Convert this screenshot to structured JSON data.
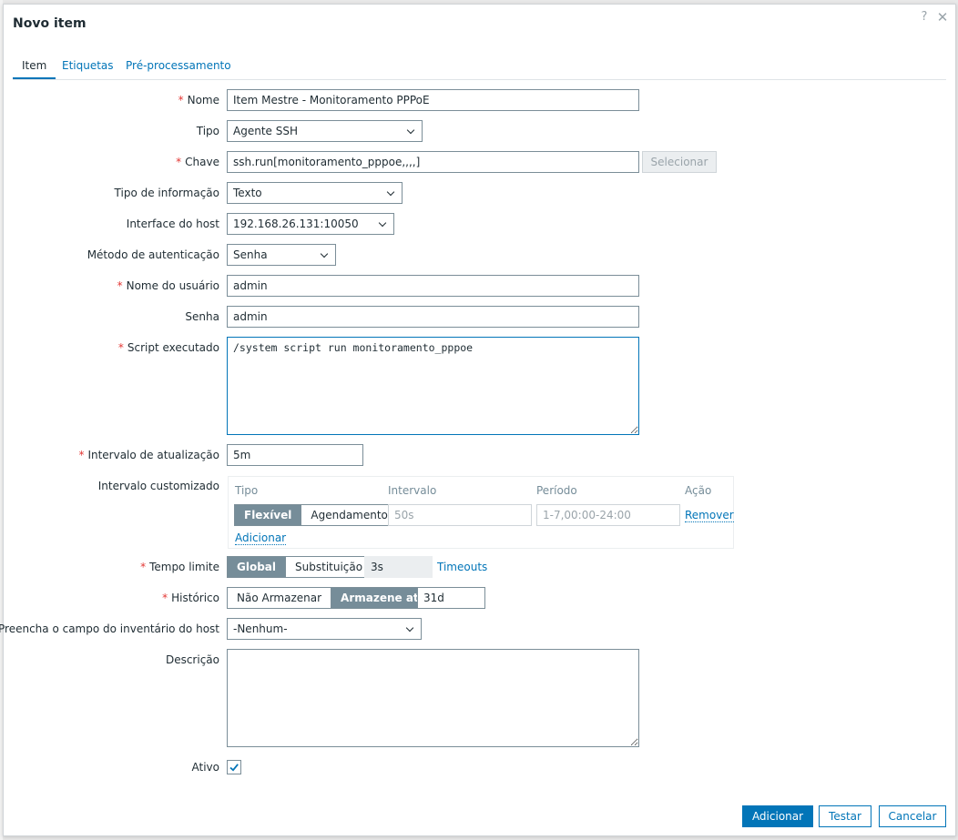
{
  "dialog": {
    "title": "Novo item",
    "help_icon": "question-mark-icon",
    "close_icon": "close-icon"
  },
  "tabs": [
    {
      "label": "Item",
      "active": true
    },
    {
      "label": "Etiquetas"
    },
    {
      "label": "Pré-processamento"
    }
  ],
  "form": {
    "nome": {
      "label": "Nome",
      "required": true,
      "value": "Item Mestre - Monitoramento PPPoE"
    },
    "tipo": {
      "label": "Tipo",
      "value": "Agente SSH"
    },
    "chave": {
      "label": "Chave",
      "required": true,
      "value": "ssh.run[monitoramento_pppoe,,,,]",
      "button": "Selecionar"
    },
    "tipo_info": {
      "label": "Tipo de informação",
      "value": "Texto"
    },
    "interface": {
      "label": "Interface do host",
      "value": "192.168.26.131:10050"
    },
    "metodo_auth": {
      "label": "Método de autenticação",
      "value": "Senha"
    },
    "usuario": {
      "label": "Nome do usuário",
      "required": true,
      "value": "admin"
    },
    "senha": {
      "label": "Senha",
      "value": "admin"
    },
    "script": {
      "label": "Script executado",
      "required": true,
      "value": "/system script run monitoramento_pppoe"
    },
    "intervalo": {
      "label": "Intervalo de atualização",
      "required": true,
      "value": "5m"
    },
    "custom_interval": {
      "label": "Intervalo customizado",
      "headers": {
        "tipo": "Tipo",
        "intervalo": "Intervalo",
        "periodo": "Período",
        "acao": "Ação"
      },
      "row": {
        "flexivel": "Flexível",
        "agendamento": "Agendamento",
        "intervalo_placeholder": "50s",
        "periodo_placeholder": "1-7,00:00-24:00",
        "remover": "Remover"
      },
      "add_link": "Adicionar"
    },
    "timeout": {
      "label": "Tempo limite",
      "required": true,
      "global": "Global",
      "substituicao": "Substituição",
      "value": "3s",
      "link": "Timeouts"
    },
    "historico": {
      "label": "Histórico",
      "required": true,
      "nao_armazenar": "Não Armazenar",
      "armazene_ate": "Armazene até",
      "value": "31d"
    },
    "inventario": {
      "label": "Preencha o campo do inventário do host",
      "value": "-Nenhum-"
    },
    "descricao": {
      "label": "Descrição",
      "value": ""
    },
    "ativo": {
      "label": "Ativo",
      "checked": true
    }
  },
  "footer": {
    "adicionar": "Adicionar",
    "testar": "Testar",
    "cancelar": "Cancelar"
  }
}
